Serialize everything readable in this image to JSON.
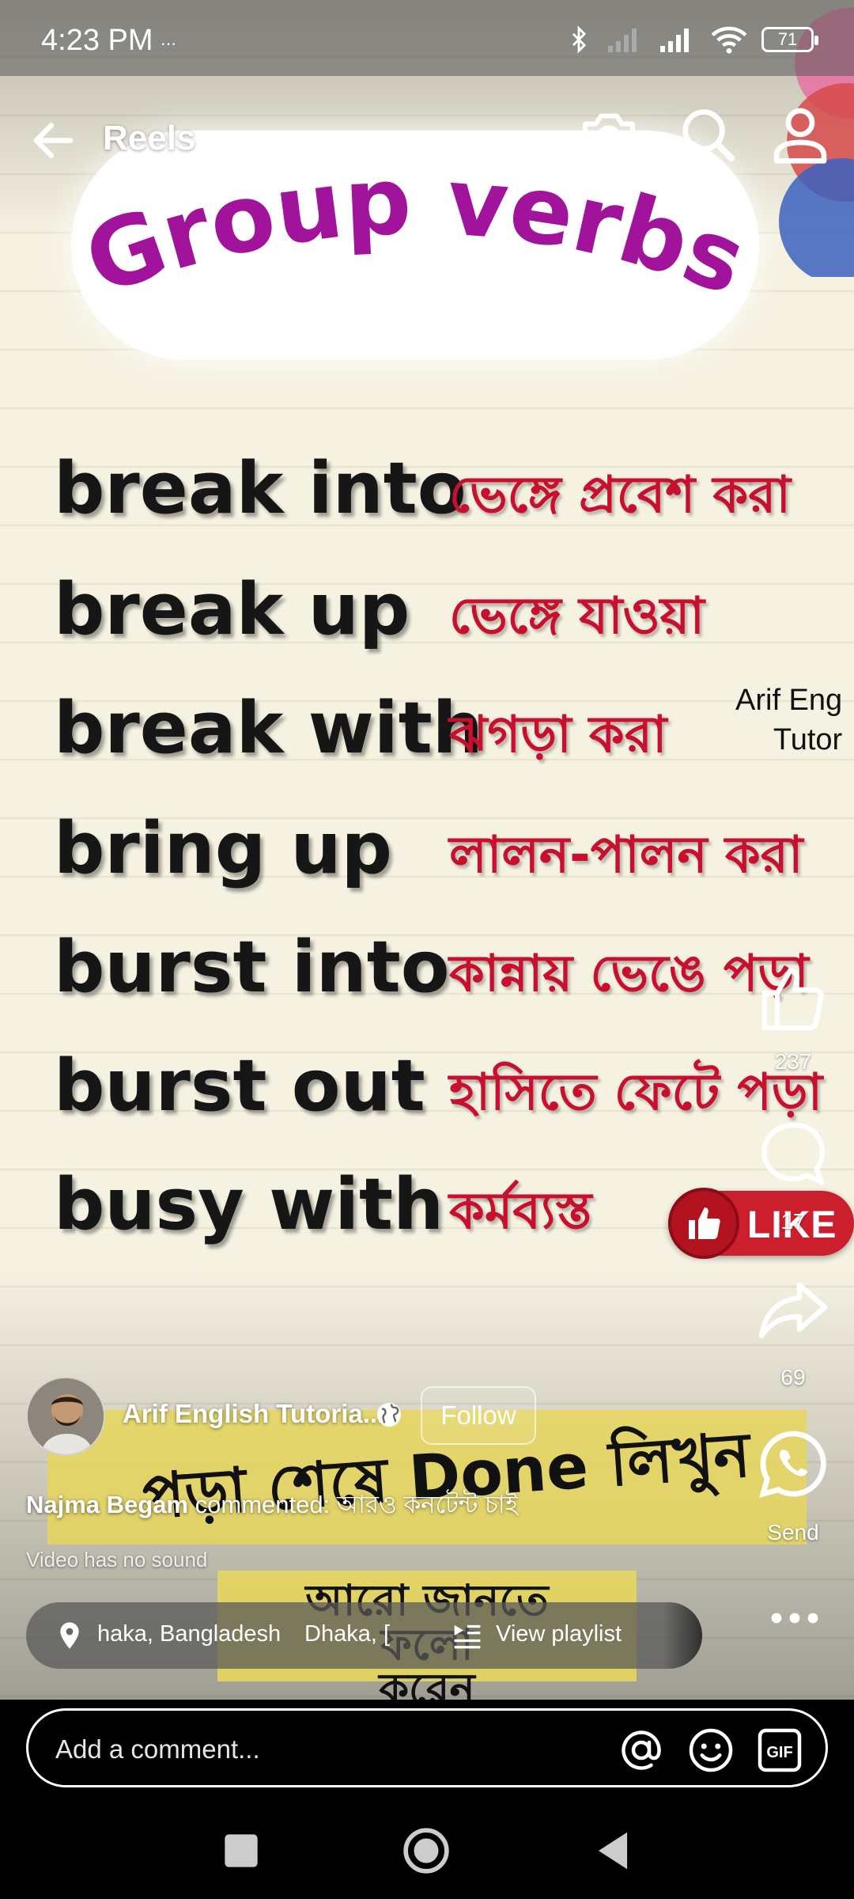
{
  "status_bar": {
    "time": "4:23 PM",
    "battery": "71"
  },
  "top_bar": {
    "title": "Reels"
  },
  "video": {
    "title": "Group verbs",
    "verbs": [
      {
        "en": "break into",
        "bn": "ভেঙ্গে প্রবেশ করা"
      },
      {
        "en": "break up",
        "bn": "ভেঙ্গে যাওয়া"
      },
      {
        "en": "break with",
        "bn": "ঝগড়া করা"
      },
      {
        "en": "bring up",
        "bn": "লালন-পালন করা"
      },
      {
        "en": "burst into",
        "bn": "কান্নায় ভেঙে পড়া"
      },
      {
        "en": "burst out",
        "bn": "হাসিতে ফেটে পড়া"
      },
      {
        "en": "busy with",
        "bn": "কর্মব্যস্ত"
      }
    ],
    "watermark_line1": "Arif Eng",
    "watermark_line2": "Tutor",
    "like_sticker": "LIKE",
    "banner1": "পড়া শেষে Done লিখুন",
    "banner2_line1": "আরো জানতে ফলো",
    "banner2_line2": "করেন"
  },
  "actions": {
    "likes": "237",
    "comments": "17",
    "shares": "69",
    "send_label": "Send"
  },
  "author": {
    "name": "Arif English Tutoria...",
    "follow_label": "Follow"
  },
  "top_comment": {
    "user": "Najma Begam",
    "text": " commented: আরও কনটেন্ট চাই"
  },
  "sound_note": "Video has no sound",
  "info_chip": {
    "location1": "haka, Bangladesh",
    "location2": "Dhaka, [",
    "playlist_label": "View playlist"
  },
  "comment_bar": {
    "placeholder": "Add a comment..."
  }
}
